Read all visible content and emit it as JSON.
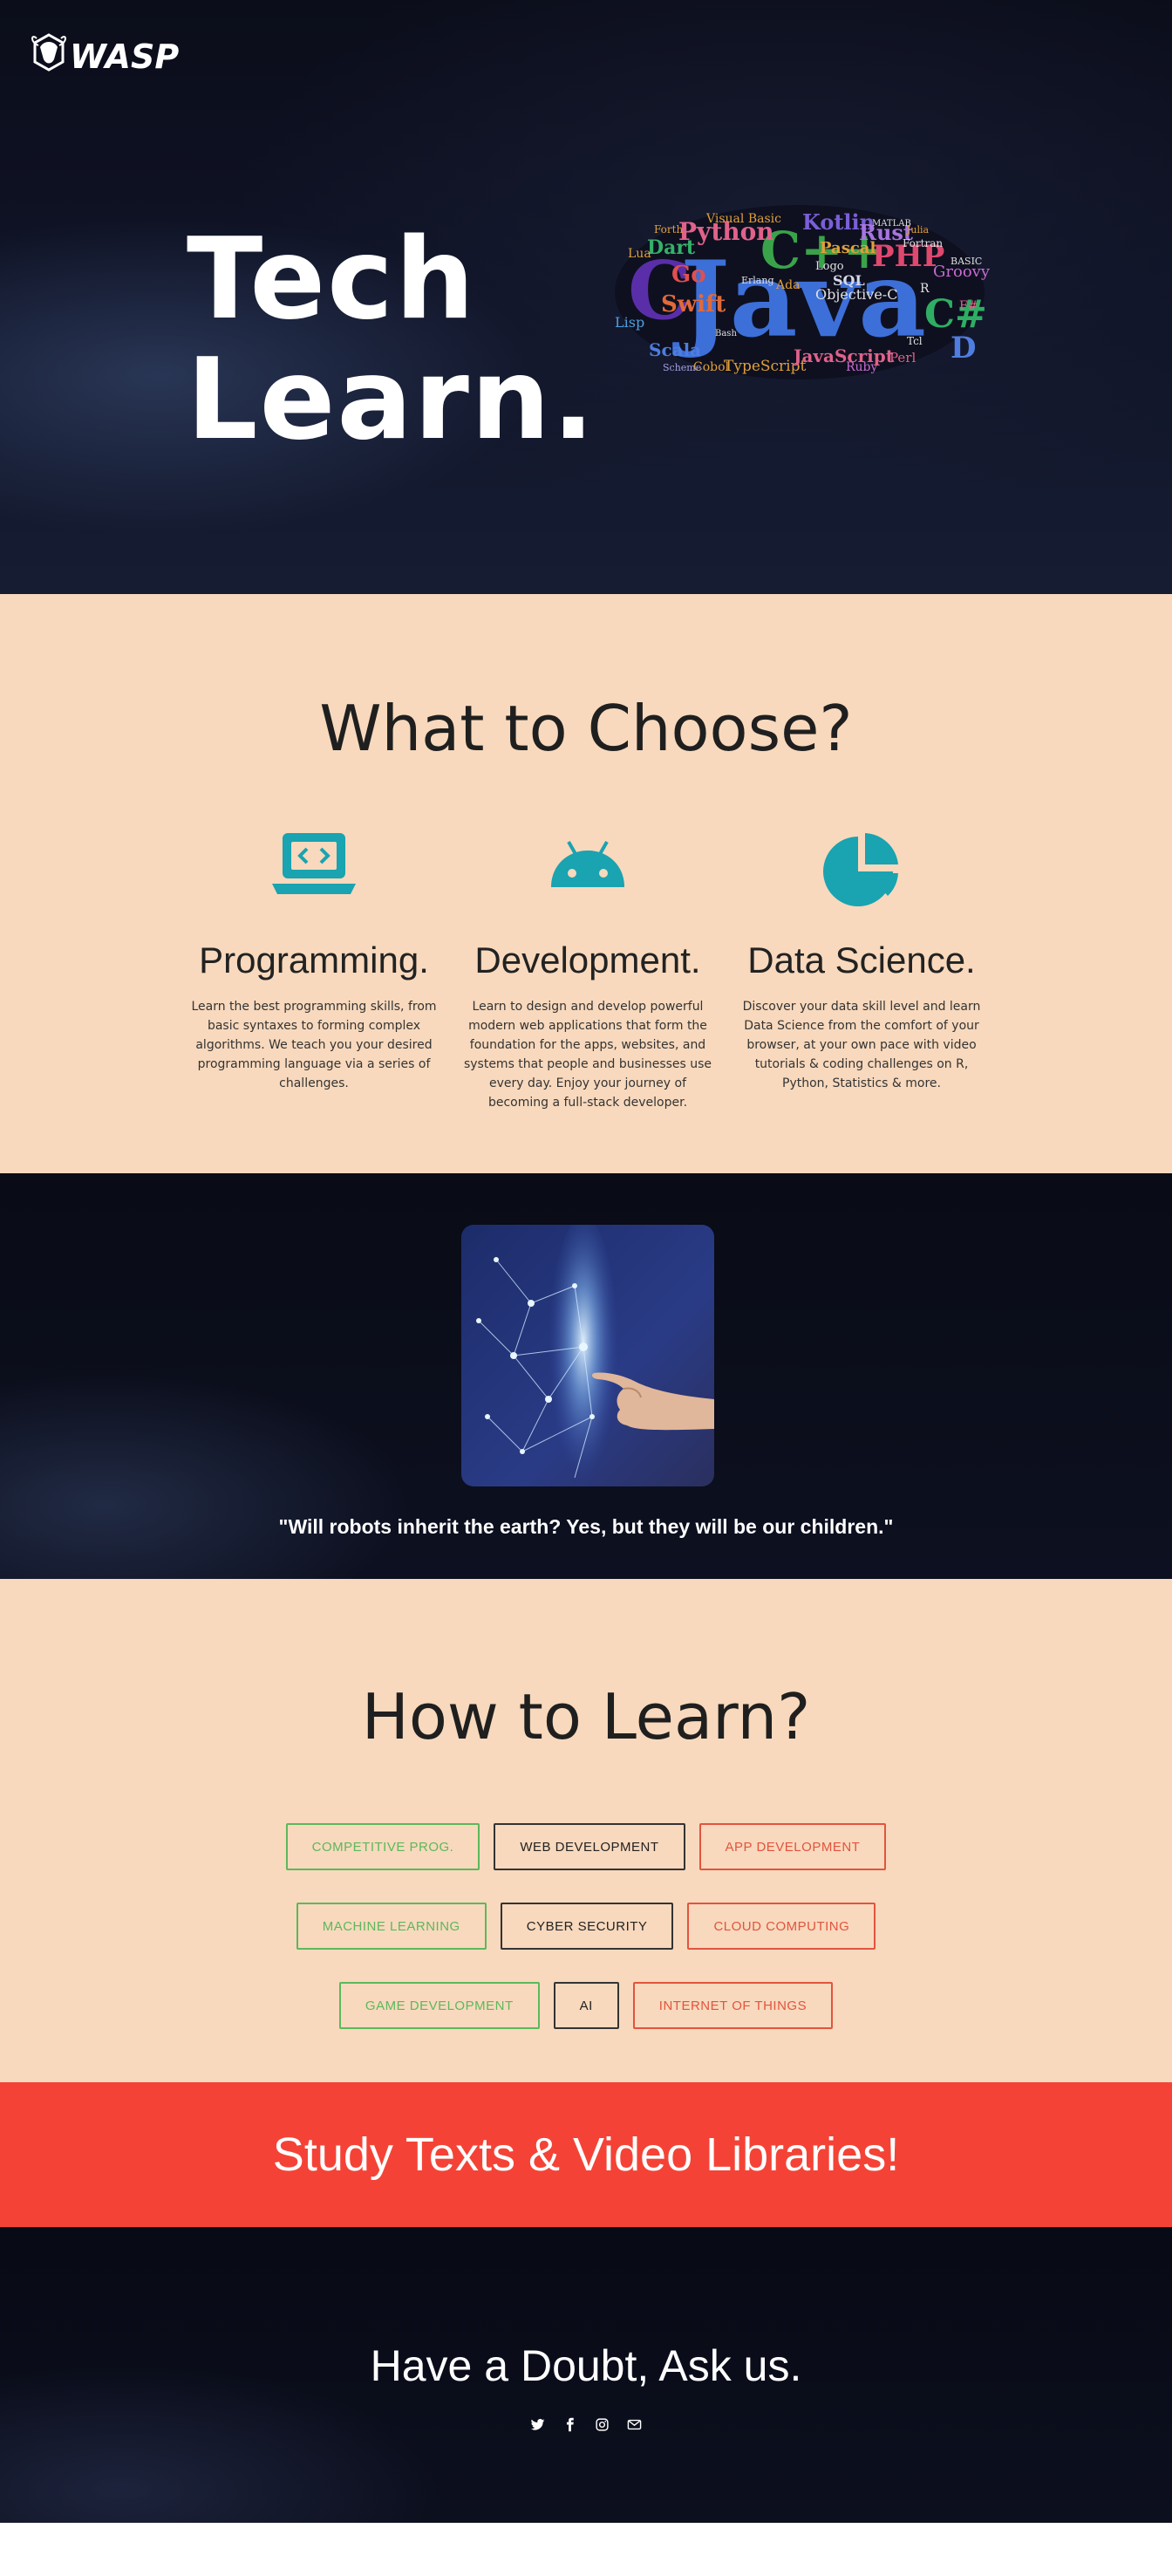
{
  "brand": {
    "logo_text": "WASP"
  },
  "hero": {
    "title_line1": "Tech",
    "title_line2": "Learn.",
    "wordcloud": {
      "main_word": "Java",
      "words": [
        "C",
        "C++",
        "C#",
        "Python",
        "PHP",
        "Kotlin",
        "Rust",
        "Swift",
        "Go",
        "Dart",
        "Scala",
        "Ruby",
        "Perl",
        "Lua",
        "Lisp",
        "SQL",
        "Pascal",
        "Objective-C",
        "TypeScript",
        "JavaScript",
        "Cobol",
        "Scheme",
        "Groovy",
        "Visual Basic",
        "Fortran",
        "Julia",
        "Erlang",
        "Logo",
        "D",
        "Tcl",
        "Ada",
        "Forth",
        "BASIC",
        "F#",
        "MATLAB",
        "R",
        "Bash"
      ]
    }
  },
  "choose": {
    "heading": "What to Choose?",
    "features": [
      {
        "icon": "laptop-code-icon",
        "title": "Programming.",
        "text": "Learn the best programming skills, from basic syntaxes to forming complex algorithms. We teach you your desired programming language via a series of challenges."
      },
      {
        "icon": "android-icon",
        "title": "Development.",
        "text": "Learn to design and develop powerful modern web applications that form the foundation for the apps, websites, and systems that people and businesses use every day. Enjoy your journey of becoming a full-stack developer."
      },
      {
        "icon": "pie-chart-icon",
        "title": "Data Science.",
        "text": "Discover your data skill level and learn Data Science from the comfort of your browser, at your own pace with video tutorials & coding challenges on R, Python, Statistics & more."
      }
    ],
    "icon_color": "#1aa3b0"
  },
  "quote": {
    "text": "\"Will robots inherit the earth? Yes, but they will be our children.\""
  },
  "learn": {
    "heading": "How to Learn?",
    "rows": [
      [
        {
          "label": "COMPETITIVE PROG.",
          "style": "green"
        },
        {
          "label": "WEB DEVELOPMENT",
          "style": "dark"
        },
        {
          "label": "APP DEVELOPMENT",
          "style": "red"
        }
      ],
      [
        {
          "label": "MACHINE LEARNING",
          "style": "green"
        },
        {
          "label": "CYBER SECURITY",
          "style": "dark"
        },
        {
          "label": "CLOUD COMPUTING",
          "style": "red"
        }
      ],
      [
        {
          "label": "GAME DEVELOPMENT",
          "style": "green"
        },
        {
          "label": "AI",
          "style": "dark"
        },
        {
          "label": "INTERNET OF THINGS",
          "style": "red"
        }
      ]
    ]
  },
  "banner": {
    "text": "Study Texts & Video Libraries!",
    "color": "#f44336"
  },
  "footer": {
    "heading": "Have a Doubt, Ask us.",
    "socials": [
      "twitter-icon",
      "facebook-icon",
      "instagram-icon",
      "email-icon"
    ]
  }
}
